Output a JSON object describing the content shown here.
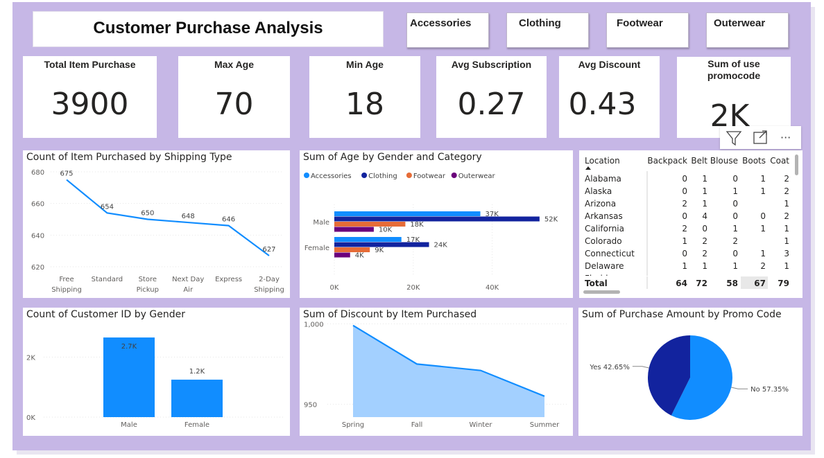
{
  "header": {
    "title": "Customer Purchase Analysis"
  },
  "slicers": [
    "Accessories",
    "Clothing",
    "Footwear",
    "Outerwear"
  ],
  "cards": [
    {
      "label": "Total Item Purchase",
      "value": "3900"
    },
    {
      "label": "Max Age",
      "value": "70"
    },
    {
      "label": "Min Age",
      "value": "18"
    },
    {
      "label": "Avg Subscription",
      "value": "0.27"
    },
    {
      "label": "Avg Discount",
      "value": "0.43"
    },
    {
      "label": "Sum of use promocode",
      "value": "2K"
    }
  ],
  "toolbar": {
    "icons": [
      "filter-icon",
      "focus-mode-icon",
      "more-options-icon"
    ],
    "more_label": "···"
  },
  "visuals": {
    "shipping": {
      "title": "Count of Item Purchased by Shipping Type",
      "color": "#118dff",
      "chart_data": {
        "type": "line",
        "categories": [
          "Free Shipping",
          "Standard",
          "Store Pickup",
          "Next Day Air",
          "Express",
          "2-Day Shipping"
        ],
        "category_lines": [
          [
            "Free",
            "Shipping"
          ],
          [
            "Standard"
          ],
          [
            "Store",
            "Pickup"
          ],
          [
            "Next Day",
            "Air"
          ],
          [
            "Express"
          ],
          [
            "2-Day",
            "Shipping"
          ]
        ],
        "values": [
          675,
          654,
          650,
          648,
          646,
          627
        ],
        "ylim": [
          620,
          680
        ],
        "yticks": [
          620,
          640,
          660,
          680
        ],
        "grid": true
      }
    },
    "age_gender": {
      "title": "Sum of Age by Gender and Category",
      "chart_data": {
        "type": "bar",
        "orientation": "horizontal",
        "categories": [
          "Male",
          "Female"
        ],
        "series": [
          {
            "name": "Accessories",
            "color": "#118dff",
            "values": [
              37000,
              17000
            ],
            "labels": [
              "37K",
              "17K"
            ]
          },
          {
            "name": "Clothing",
            "color": "#12239e",
            "values": [
              52000,
              24000
            ],
            "labels": [
              "52K",
              "24K"
            ]
          },
          {
            "name": "Footwear",
            "color": "#e66c37",
            "values": [
              18000,
              9000
            ],
            "labels": [
              "18K",
              "9K"
            ]
          },
          {
            "name": "Outerwear",
            "color": "#6b007b",
            "values": [
              10000,
              4000
            ],
            "labels": [
              "10K",
              "4K"
            ]
          }
        ],
        "xlim": [
          0,
          58000
        ],
        "xticks": [
          0,
          20000,
          40000
        ],
        "xtick_labels": [
          "0K",
          "20K",
          "40K"
        ],
        "legend": "top-left",
        "grid": true
      }
    },
    "matrix": {
      "chart_data": {
        "type": "table",
        "columns": [
          "Location",
          "Backpack",
          "Belt",
          "Blouse",
          "Boots",
          "Coat"
        ],
        "rows": [
          [
            "Alabama",
            "0",
            "1",
            "0",
            "1",
            "2"
          ],
          [
            "Alaska",
            "0",
            "1",
            "1",
            "1",
            "2"
          ],
          [
            "Arizona",
            "2",
            "1",
            "0",
            "",
            "1"
          ],
          [
            "Arkansas",
            "0",
            "4",
            "0",
            "0",
            "2"
          ],
          [
            "California",
            "2",
            "0",
            "1",
            "1",
            "1"
          ],
          [
            "Colorado",
            "1",
            "2",
            "2",
            "",
            "1"
          ],
          [
            "Connecticut",
            "0",
            "2",
            "0",
            "1",
            "3"
          ],
          [
            "Delaware",
            "1",
            "1",
            "1",
            "2",
            "1"
          ],
          [
            "Florida",
            "",
            "",
            "",
            "",
            ""
          ]
        ],
        "total": [
          "Total",
          "64",
          "72",
          "58",
          "67",
          "79"
        ]
      }
    },
    "gender_count": {
      "title": "Count of Customer ID by Gender",
      "color": "#118dff",
      "chart_data": {
        "type": "bar",
        "categories": [
          "Male",
          "Female"
        ],
        "values": [
          2652,
          1248
        ],
        "labels": [
          "2.7K",
          "1.2K"
        ],
        "ylim": [
          0,
          3000
        ],
        "yticks": [
          0,
          2000
        ],
        "ytick_labels": [
          "0K",
          "2K"
        ],
        "grid": true
      }
    },
    "discount": {
      "title": "Sum of Discount by Item Purchased",
      "line_color": "#118dff",
      "fill_color": "#a3d0ff",
      "chart_data": {
        "type": "area",
        "categories": [
          "Spring",
          "Fall",
          "Winter",
          "Summer"
        ],
        "values": [
          999,
          975,
          971,
          955
        ],
        "ylim": [
          942,
          1001
        ],
        "yticks": [
          950,
          1000
        ],
        "ytick_labels": [
          "950",
          "1,000"
        ],
        "grid": true
      }
    },
    "promo": {
      "title": "Sum of Purchase Amount by Promo Code",
      "chart_data": {
        "type": "pie",
        "slices": [
          {
            "name": "Yes",
            "value": 42.65,
            "label": "Yes 42.65%",
            "color": "#12239e"
          },
          {
            "name": "No",
            "value": 57.35,
            "label": "No 57.35%",
            "color": "#118dff"
          }
        ]
      }
    }
  }
}
